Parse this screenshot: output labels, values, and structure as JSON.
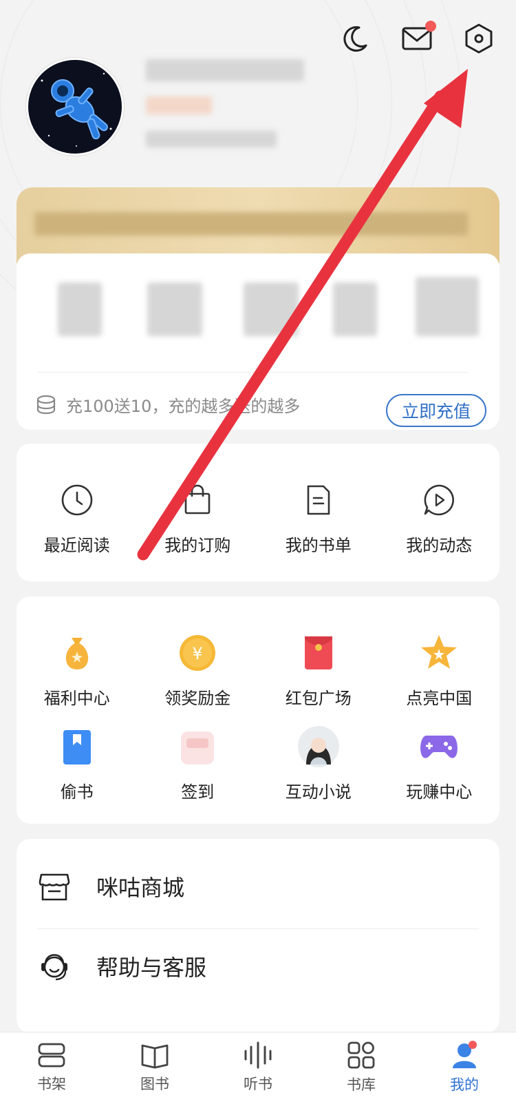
{
  "header": {
    "night_mode_icon": "moon-icon",
    "message_icon": "mail-icon",
    "settings_icon": "settings-hexagon-icon"
  },
  "promo": {
    "text": "充100送10，充的越多送的越多",
    "button": "立即充值"
  },
  "quick": [
    {
      "label": "最近阅读",
      "icon": "clock-icon"
    },
    {
      "label": "我的订购",
      "icon": "bag-icon"
    },
    {
      "label": "我的书单",
      "icon": "document-icon"
    },
    {
      "label": "我的动态",
      "icon": "play-bubble-icon"
    }
  ],
  "services": [
    {
      "label": "福利中心",
      "icon": "money-bag-icon"
    },
    {
      "label": "领奖励金",
      "icon": "yen-coin-icon"
    },
    {
      "label": "红包广场",
      "icon": "red-envelope-icon"
    },
    {
      "label": "点亮中国",
      "icon": "star-icon"
    },
    {
      "label": "偷书",
      "icon": "bookmark-book-icon"
    },
    {
      "label": "签到",
      "icon": "checkin-icon"
    },
    {
      "label": "互动小说",
      "icon": "novel-portrait-icon"
    },
    {
      "label": "玩赚中心",
      "icon": "gamepad-icon"
    }
  ],
  "menu": [
    {
      "label": "咪咕商城",
      "icon": "shop-icon"
    },
    {
      "label": "帮助与客服",
      "icon": "customer-service-icon"
    }
  ],
  "tabs": [
    {
      "label": "书架",
      "icon": "bookshelf-icon"
    },
    {
      "label": "图书",
      "icon": "open-book-icon"
    },
    {
      "label": "听书",
      "icon": "audio-wave-icon"
    },
    {
      "label": "书库",
      "icon": "grid-icon"
    },
    {
      "label": "我的",
      "icon": "profile-icon",
      "active": true
    }
  ],
  "colors": {
    "accent": "#2e72d2",
    "badge": "#f25a5a",
    "arrow": "#e8333f"
  }
}
